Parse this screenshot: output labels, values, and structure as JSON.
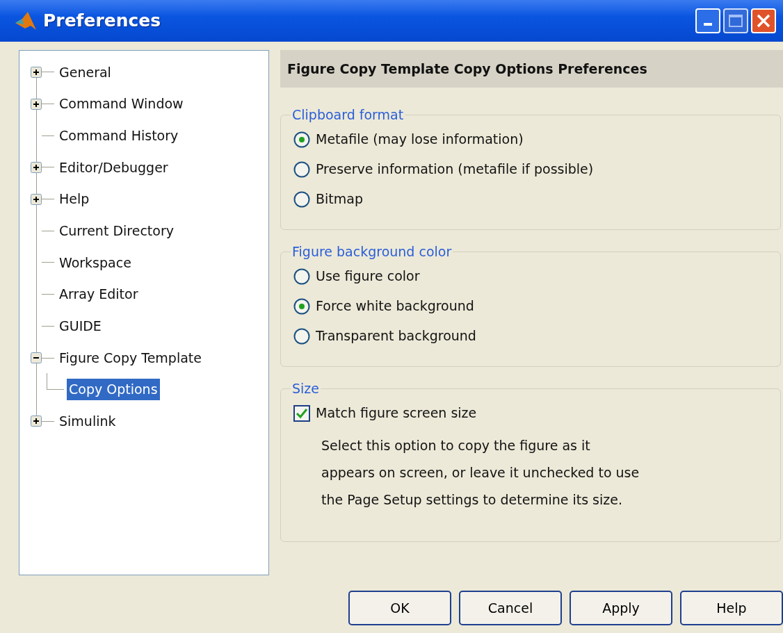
{
  "window": {
    "title": "Preferences"
  },
  "tree": [
    {
      "label": "General",
      "kind": "folder",
      "expanded": false,
      "selected": false
    },
    {
      "label": "Command Window",
      "kind": "folder",
      "expanded": false,
      "selected": false
    },
    {
      "label": "Command History",
      "kind": "leaf",
      "selected": false
    },
    {
      "label": "Editor/Debugger",
      "kind": "folder",
      "expanded": false,
      "selected": false
    },
    {
      "label": "Help",
      "kind": "folder",
      "expanded": false,
      "selected": false
    },
    {
      "label": "Current Directory",
      "kind": "leaf",
      "selected": false
    },
    {
      "label": "Workspace",
      "kind": "leaf",
      "selected": false
    },
    {
      "label": "Array Editor",
      "kind": "leaf",
      "selected": false
    },
    {
      "label": "GUIDE",
      "kind": "leaf",
      "selected": false
    },
    {
      "label": "Figure Copy Template",
      "kind": "folder",
      "expanded": true,
      "selected": false,
      "children": [
        {
          "label": "Copy Options",
          "selected": true
        }
      ]
    },
    {
      "label": "Simulink",
      "kind": "folder",
      "expanded": false,
      "selected": false
    }
  ],
  "panel_title": "Figure Copy Template Copy Options Preferences",
  "groups": [
    {
      "title": "Clipboard format",
      "kind": "radio",
      "options": [
        {
          "label": "Metafile (may lose information)",
          "selected": true
        },
        {
          "label": "Preserve information (metafile if possible)",
          "selected": false
        },
        {
          "label": "Bitmap",
          "selected": false
        }
      ]
    },
    {
      "title": "Figure background color",
      "kind": "radio",
      "options": [
        {
          "label": "Use figure color",
          "selected": false
        },
        {
          "label": "Force white background",
          "selected": true
        },
        {
          "label": "Transparent background",
          "selected": false
        }
      ]
    },
    {
      "title": "Size",
      "kind": "checkbox",
      "options": [
        {
          "label": "Match figure screen size",
          "checked": true
        }
      ],
      "description": [
        "Select this option to copy the figure as it",
        "appears on screen, or leave it unchecked to use",
        "the Page Setup settings to determine its size."
      ]
    }
  ],
  "buttons": [
    "OK",
    "Cancel",
    "Apply",
    "Help"
  ]
}
